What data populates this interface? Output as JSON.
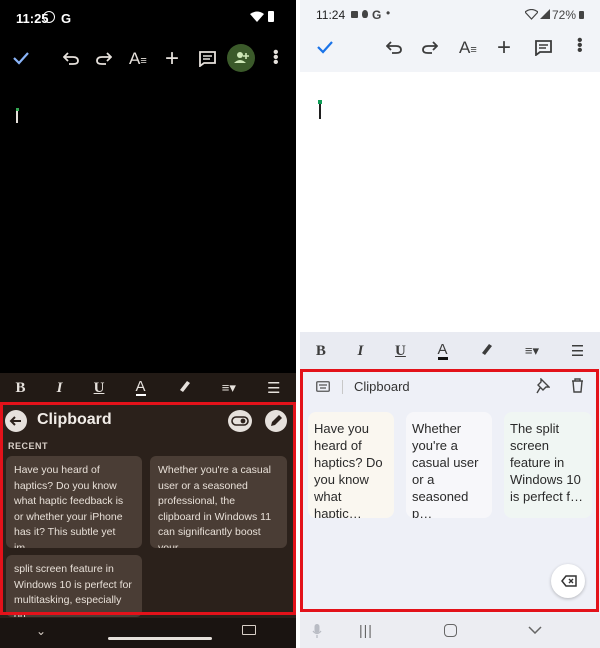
{
  "left": {
    "status_bar": {
      "time": "11:25",
      "g_glyph": "G"
    },
    "clipboard": {
      "title": "Clipboard",
      "section": "RECENT",
      "items": [
        {
          "text": "Have you heard of haptics? Do you know what haptic feedback is or whether your iPhone has it? This subtle yet im…"
        },
        {
          "text": "Whether you're a casual user or a seasoned professional, the clipboard in Windows 11 can significantly boost your …"
        },
        {
          "text": "split screen feature in Windows 10 is perfect for multitasking, especially on"
        }
      ]
    }
  },
  "right": {
    "status_bar": {
      "time": "11:24",
      "g_glyph": "G",
      "battery": "72%"
    },
    "clipboard": {
      "title": "Clipboard",
      "items": [
        {
          "text": "Have you heard of haptics? Do you know what haptic…"
        },
        {
          "text": "Whether you're a casual user or a seasoned p…"
        },
        {
          "text": "The split screen feature in Windows 10 is perfect f…"
        }
      ]
    }
  },
  "icons": [
    "check-icon",
    "undo-icon",
    "redo-icon",
    "text-format-icon",
    "add-icon",
    "comment-icon",
    "add-person-icon",
    "more-icon",
    "bold-icon",
    "italic-icon",
    "underline-icon",
    "text-color-icon",
    "highlight-icon",
    "align-icon",
    "list-icon",
    "back-arrow-icon",
    "toggle-icon",
    "edit-icon",
    "keyboard-icon",
    "pin-icon",
    "delete-icon",
    "backspace-icon",
    "mic-icon",
    "recents-icon",
    "home-icon",
    "back-icon",
    "chevron-down-icon"
  ],
  "colors": {
    "highlight_box": "#e3121a",
    "accent_blue": "#1a73e8",
    "left_panel_bg": "#2b211b",
    "right_panel_bg": "#eef0f7"
  }
}
